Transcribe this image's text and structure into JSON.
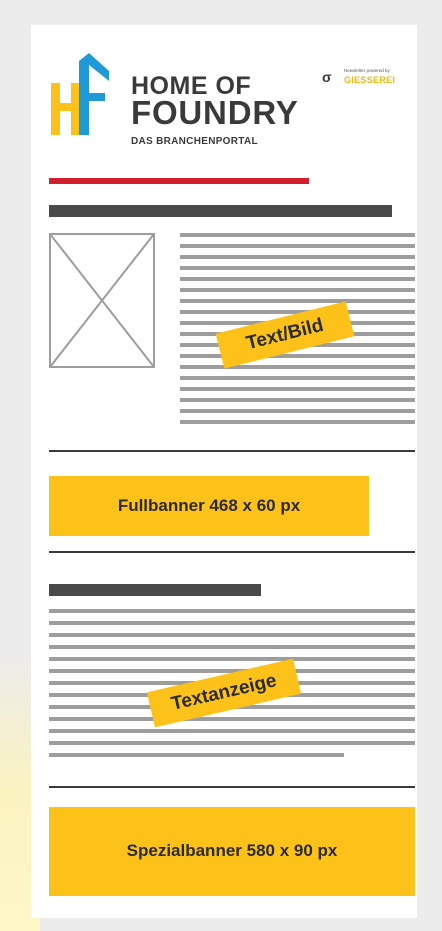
{
  "header": {
    "brand_line1": "HOME OF",
    "brand_line2": "FOUNDRY",
    "brand_line3": "DAS BRANCHENPORTAL",
    "publisher_powered": "Newsletter powered by",
    "publisher_name": "GIESSEREI"
  },
  "blocks": {
    "text_image_label": "Text/Bild",
    "fullbanner_label": "Fullbanner 468 x 60 px",
    "text_ad_label": "Textanzeige",
    "special_banner_label": "Spezialbanner 580 x 90 px"
  },
  "colors": {
    "accent_yellow": "#fcc21a",
    "accent_red": "#d0202e",
    "logo_blue": "#1f9ad6",
    "text_dark": "#3a3a3c"
  },
  "icons": [
    "home-of-foundry-logo",
    "giesserei-logo",
    "image-placeholder-icon"
  ]
}
